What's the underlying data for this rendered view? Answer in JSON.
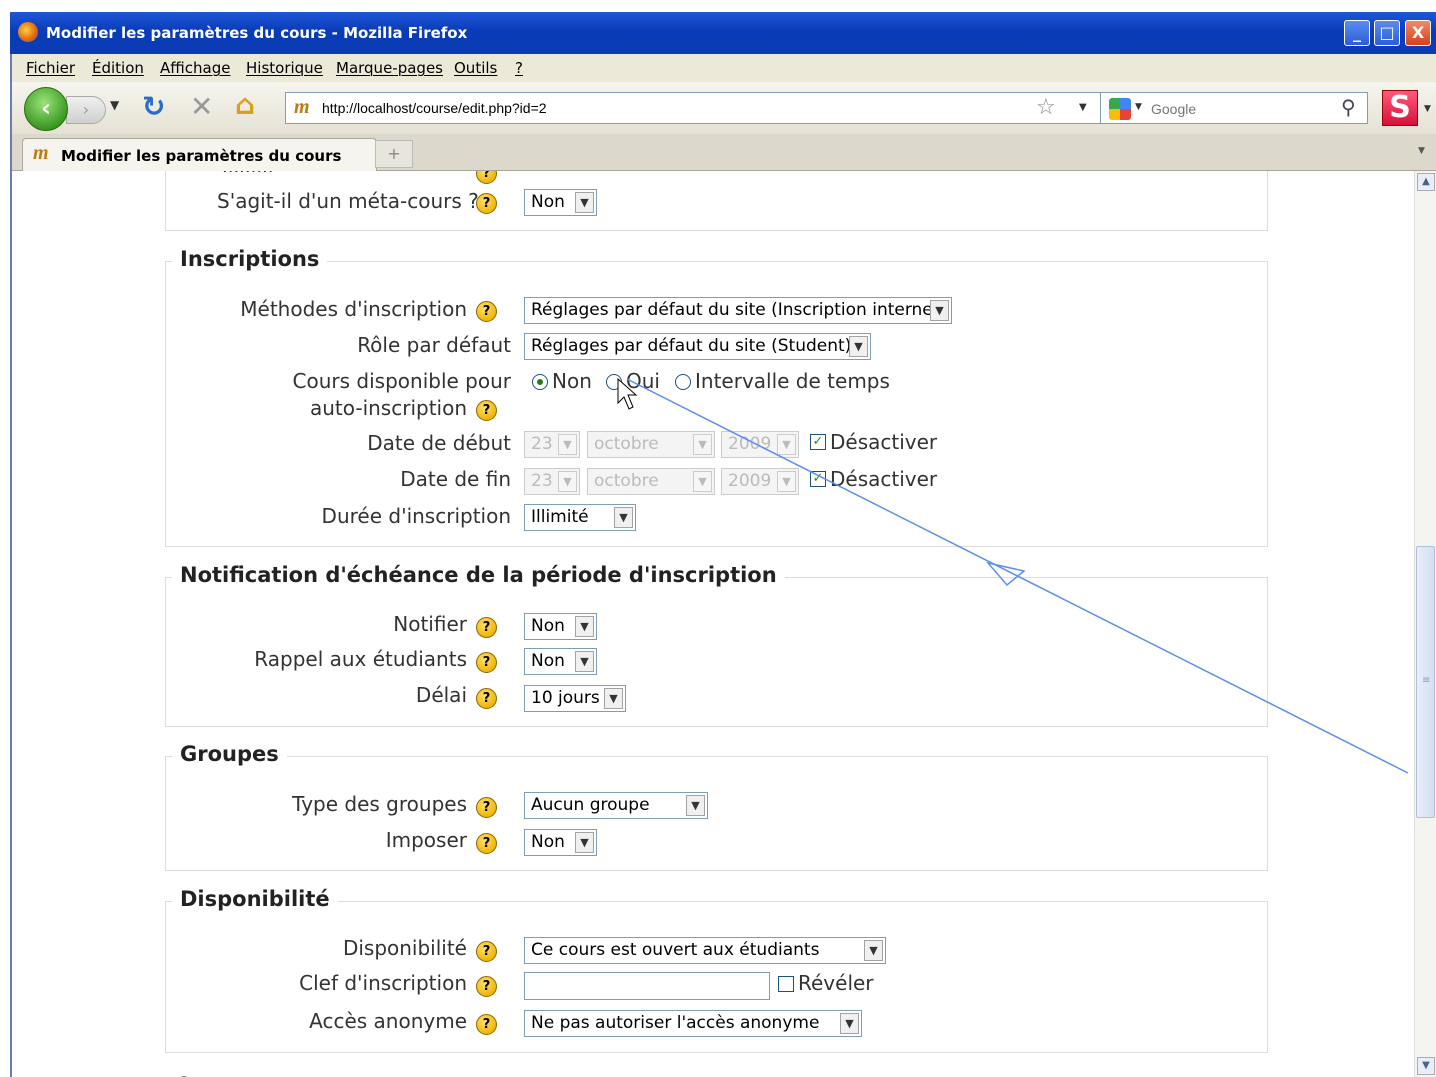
{
  "window": {
    "title": "Modifier les paramètres du cours - Mozilla Firefox",
    "min": "_",
    "max": "□",
    "close": "X"
  },
  "menu": [
    "Fichier",
    "Édition",
    "Affichage",
    "Historique",
    "Marque-pages",
    "Outils",
    "?"
  ],
  "nav": {
    "url": "http://localhost/course/edit.php?id=2",
    "search_placeholder": "Google"
  },
  "tab": {
    "title": "Modifier les paramètres du cours",
    "new_tab": "+"
  },
  "form": {
    "meta": {
      "label": "S'agit-il d'un méta-cours ?",
      "value": "Non"
    },
    "inscriptions": {
      "legend": "Inscriptions",
      "methodes": {
        "label": "Méthodes d'inscription",
        "value": "Réglages par défaut du site (Inscription interne)"
      },
      "role": {
        "label": "Rôle par défaut",
        "value": "Réglages par défaut du site (Student)"
      },
      "dispo": {
        "label1": "Cours disponible pour",
        "label2": "auto-inscription",
        "options": [
          "Non",
          "Oui",
          "Intervalle de temps"
        ],
        "selected": "Non"
      },
      "debut": {
        "label": "Date de début",
        "day": "23",
        "month": "octobre",
        "year": "2009",
        "disable": "Désactiver"
      },
      "fin": {
        "label": "Date de fin",
        "day": "23",
        "month": "octobre",
        "year": "2009",
        "disable": "Désactiver"
      },
      "duree": {
        "label": "Durée d'inscription",
        "value": "Illimité"
      }
    },
    "notification": {
      "legend": "Notification d'échéance de la période d'inscription",
      "notifier": {
        "label": "Notifier",
        "value": "Non"
      },
      "rappel": {
        "label": "Rappel aux étudiants",
        "value": "Non"
      },
      "delai": {
        "label": "Délai",
        "value": "10 jours"
      }
    },
    "groupes": {
      "legend": "Groupes",
      "type": {
        "label": "Type des groupes",
        "value": "Aucun groupe"
      },
      "imposer": {
        "label": "Imposer",
        "value": "Non"
      }
    },
    "disponibilite": {
      "legend": "Disponibilité",
      "dispo": {
        "label": "Disponibilité",
        "value": "Ce cours est ouvert aux étudiants"
      },
      "clef": {
        "label": "Clef d'inscription",
        "value": "",
        "reveal": "Révéler"
      },
      "anonyme": {
        "label": "Accès anonyme",
        "value": "Ne pas autoriser l'accès anonyme"
      }
    }
  },
  "help_glyph": "?",
  "colors": {
    "titlebar": "#0a3bb8",
    "annotation_arrow": "#5b8ff0",
    "help_icon": "#f1b40a"
  }
}
